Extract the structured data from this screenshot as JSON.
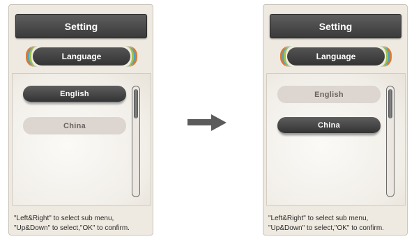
{
  "screens": [
    {
      "title": "Setting",
      "section": "Language",
      "options": [
        {
          "label": "English",
          "selected": true
        },
        {
          "label": "China",
          "selected": false
        }
      ],
      "hint": [
        "\"Left&Right\" to select sub menu,",
        "\"Up&Down\" to select,\"OK\" to confirm."
      ]
    },
    {
      "title": "Setting",
      "section": "Language",
      "options": [
        {
          "label": "English",
          "selected": false
        },
        {
          "label": "China",
          "selected": true
        }
      ],
      "hint": [
        "\"Left&Right\" to select sub menu,",
        "\"Up&Down\" to select,\"OK\" to confirm."
      ]
    }
  ],
  "colors": {
    "panel_bg": "#efeae1",
    "title_bar": "#444444",
    "selected_option": "#444444",
    "unselected_option": "#ddd5cf",
    "ring_orange": "#e0782e",
    "ring_blue": "#4aa5c9",
    "ring_green": "#a5c348",
    "arrow": "#5b5b5b"
  },
  "icons": {
    "transition": "right-arrow-icon"
  }
}
